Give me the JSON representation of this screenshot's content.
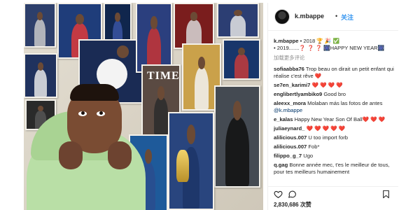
{
  "post": {
    "author": {
      "username": "k.mbappe",
      "dot": "•",
      "follow_label": "关注"
    },
    "caption": {
      "username": "k.mbappe",
      "line1": "• 2018 🏆 🎉 ✅",
      "line2": "• 2019.......❓ ❓ ❓ 🎆HAPPY NEW YEAR🎆"
    },
    "translate_label": "加载更多评论",
    "comments": [
      {
        "user": "sofiaabba76",
        "text": "Trop beau on dirait un petit enfant qui réalise c'est rêve ❤️"
      },
      {
        "user": "se7en_karimi7",
        "text": "❤️ ❤️ ❤️ ❤️"
      },
      {
        "user": "englibertlyambiko9",
        "text": "Good bro"
      },
      {
        "user": "aleexx_mora",
        "text": "Molaban más las fotos de antes",
        "mention": "@k.mbappe"
      },
      {
        "user": "e_kalas",
        "text": "Happy New Year Son Of Ball❤️ ❤️ ❤️"
      },
      {
        "user": "juliaeynard_",
        "text": "❤️ ❤️ ❤️ ❤️ ❤️"
      },
      {
        "user": "alilicious.007",
        "text": "U too import forb"
      },
      {
        "user": "alilicious.007",
        "text": "Fob*"
      },
      {
        "user": "filippo_g_7",
        "text": "Ugo"
      },
      {
        "user": "q.gag",
        "text": "Bonne année mec, t'es le meilleur de tous, pour tes meilleurs humainement"
      }
    ],
    "likes_text": "2,830,686 次赞",
    "icons": {
      "like": "heart-icon",
      "comment": "comment-icon",
      "save": "bookmark-icon",
      "verified": "verified-icon"
    },
    "colors": {
      "accent": "#3897f0",
      "text": "#262626",
      "muted": "#8e8e8e",
      "hoodie": "#b9dfa6"
    },
    "photo": {
      "poster_text": "TIME"
    }
  }
}
